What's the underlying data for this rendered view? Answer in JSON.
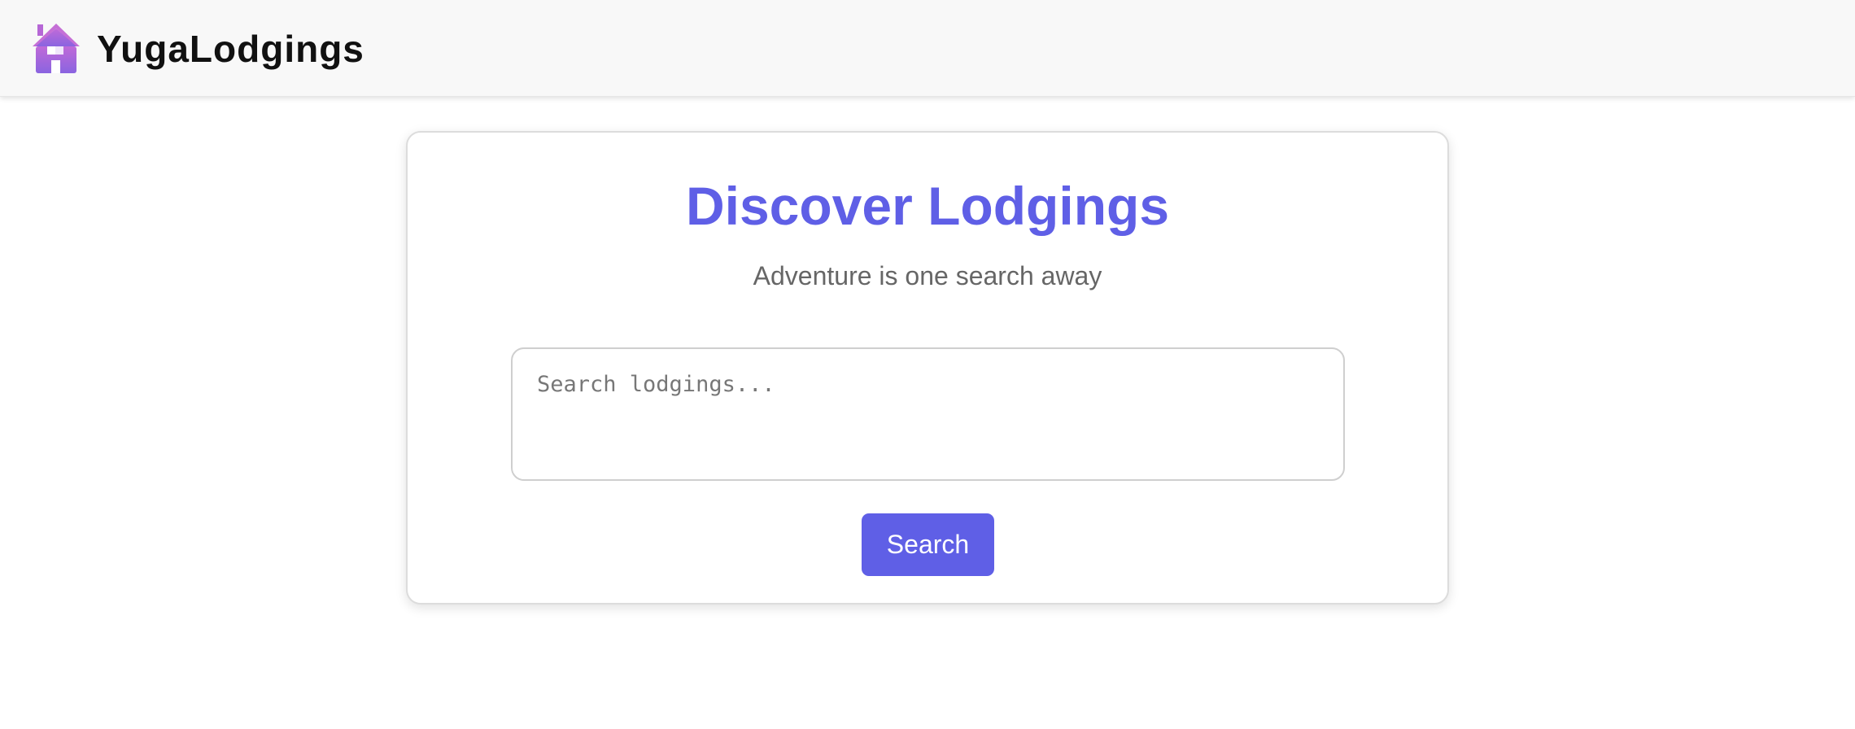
{
  "header": {
    "brand": "YugaLodgings",
    "logo_icon": "house-icon",
    "background_color": "#f8f8f8"
  },
  "search_card": {
    "title": "Discover Lodgings",
    "subtitle": "Adventure is one search away",
    "search_input": {
      "value": "",
      "placeholder": "Search lodgings..."
    },
    "search_button_label": "Search"
  },
  "colors": {
    "accent": "#5f5fe6",
    "logo_gradient_top": "#c06ad8",
    "logo_gradient_bottom": "#8a64e0",
    "subtitle": "#666666"
  }
}
